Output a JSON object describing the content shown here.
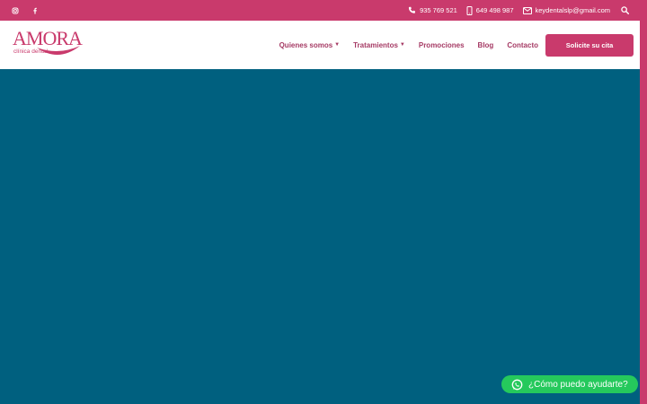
{
  "topbar": {
    "social": [
      "instagram-icon",
      "facebook-icon"
    ],
    "phone": "935 769 521",
    "mobile": "649 498 987",
    "email": "keydentalslp@gmail.com"
  },
  "logo": {
    "brand": "AMORA",
    "sub": "clínica dental"
  },
  "nav": {
    "quienes": "Quienes somos",
    "tratamientos": "Tratamientos",
    "promociones": "Promociones",
    "blog": "Blog",
    "contacto": "Contacto"
  },
  "cta": {
    "label": "Solicite su cita"
  },
  "whatsapp": {
    "label": "¿Cómo puedo ayudarte?"
  },
  "colors": {
    "brand": "#c93a6c",
    "hero": "#00607f",
    "whatsapp": "#25c95c",
    "nav_text": "#a53a64"
  }
}
